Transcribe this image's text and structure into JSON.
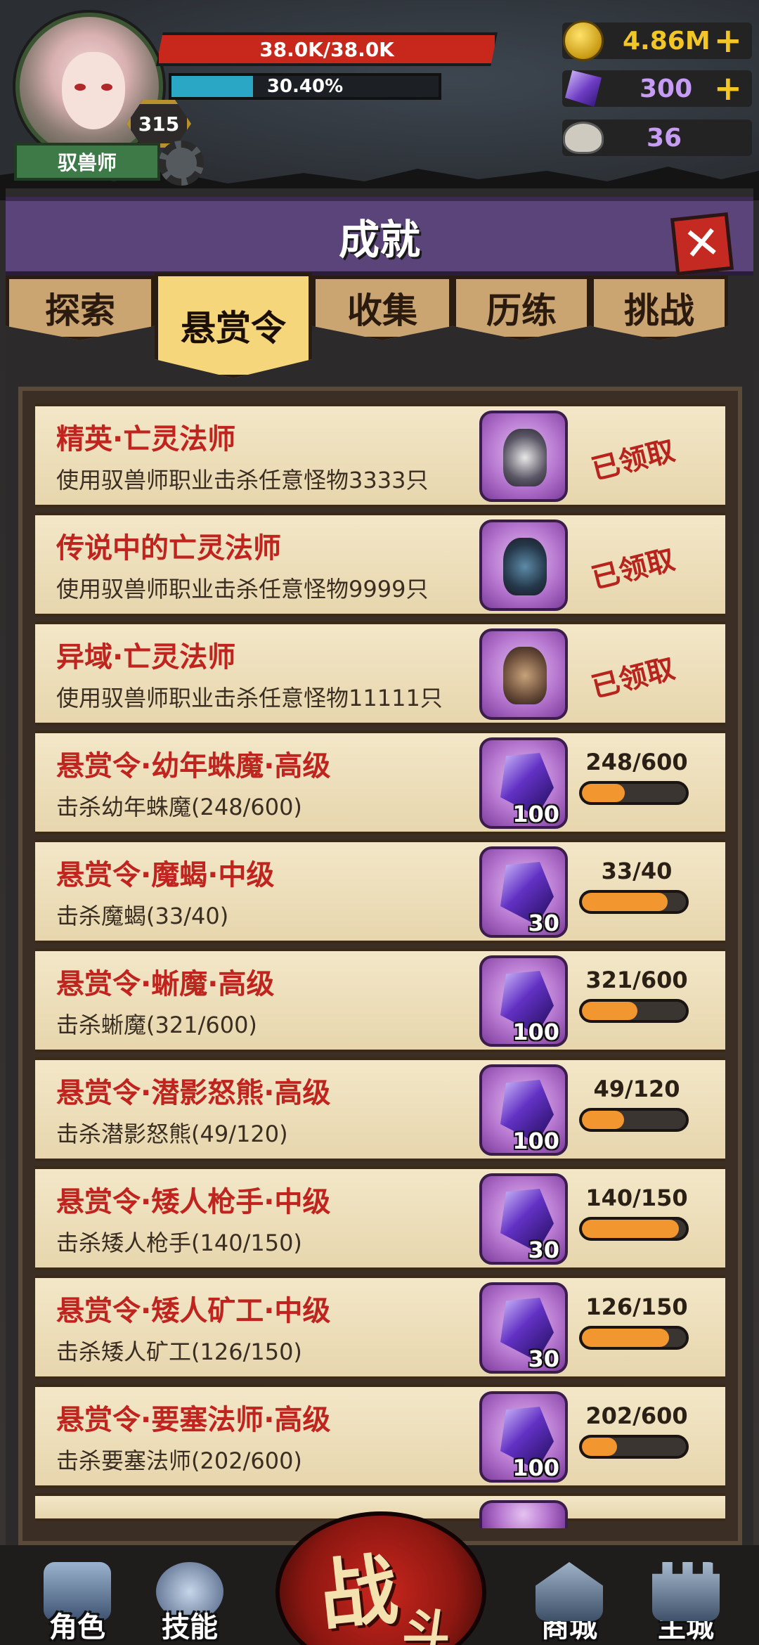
{
  "hud": {
    "hp_text": "38.0K/38.0K",
    "xp_text": "30.40%",
    "xp_percent": 30.4,
    "level": "315",
    "class_name": "驭兽师",
    "gold": "4.86M",
    "gems": "300",
    "skulls": "36",
    "gold_plus": "+",
    "gems_plus": "+"
  },
  "panel": {
    "title": "成就",
    "close_symbol": "✕",
    "tabs": [
      "探索",
      "悬赏令",
      "收集",
      "历练",
      "挑战"
    ],
    "active_tab": 1
  },
  "items": [
    {
      "name": "精英·亡灵法师",
      "desc": "使用驭兽师职业击杀任意怪物3333只",
      "reward": "portrait",
      "status": "已领取"
    },
    {
      "name": "传说中的亡灵法师",
      "desc": "使用驭兽师职业击杀任意怪物9999只",
      "reward": "portrait",
      "status": "已领取"
    },
    {
      "name": "异域·亡灵法师",
      "desc": "使用驭兽师职业击杀任意怪物11111只",
      "reward": "portrait",
      "status": "已领取"
    },
    {
      "name": "悬赏令·幼年蛛魔·高级",
      "desc": "击杀幼年蛛魔(248/600)",
      "reward": "crystal",
      "qty": "100",
      "progress": "248/600",
      "fraction": 0.413
    },
    {
      "name": "悬赏令·魔蝎·中级",
      "desc": "击杀魔蝎(33/40)",
      "reward": "crystal",
      "qty": "30",
      "progress": "33/40",
      "fraction": 0.825
    },
    {
      "name": "悬赏令·蜥魔·高级",
      "desc": "击杀蜥魔(321/600)",
      "reward": "crystal",
      "qty": "100",
      "progress": "321/600",
      "fraction": 0.535
    },
    {
      "name": "悬赏令·潜影怒熊·高级",
      "desc": "击杀潜影怒熊(49/120)",
      "reward": "crystal",
      "qty": "100",
      "progress": "49/120",
      "fraction": 0.408
    },
    {
      "name": "悬赏令·矮人枪手·中级",
      "desc": "击杀矮人枪手(140/150)",
      "reward": "crystal",
      "qty": "30",
      "progress": "140/150",
      "fraction": 0.933
    },
    {
      "name": "悬赏令·矮人矿工·中级",
      "desc": "击杀矮人矿工(126/150)",
      "reward": "crystal",
      "qty": "30",
      "progress": "126/150",
      "fraction": 0.84
    },
    {
      "name": "悬赏令·要塞法师·高级",
      "desc": "击杀要塞法师(202/600)",
      "reward": "crystal",
      "qty": "100",
      "progress": "202/600",
      "fraction": 0.337
    }
  ],
  "nav": {
    "role": "角色",
    "skills": "技能",
    "battle_1": "战",
    "battle_2": "斗",
    "shop": "商城",
    "city": "主城"
  },
  "colors": {
    "title_purple": "#5b447a",
    "active_tab": "#f5d67a",
    "item_name_red": "#c0241e",
    "progress_orange": "#f2962f",
    "hp_red": "#c8271b",
    "xp_cyan": "#2aa7c4"
  }
}
